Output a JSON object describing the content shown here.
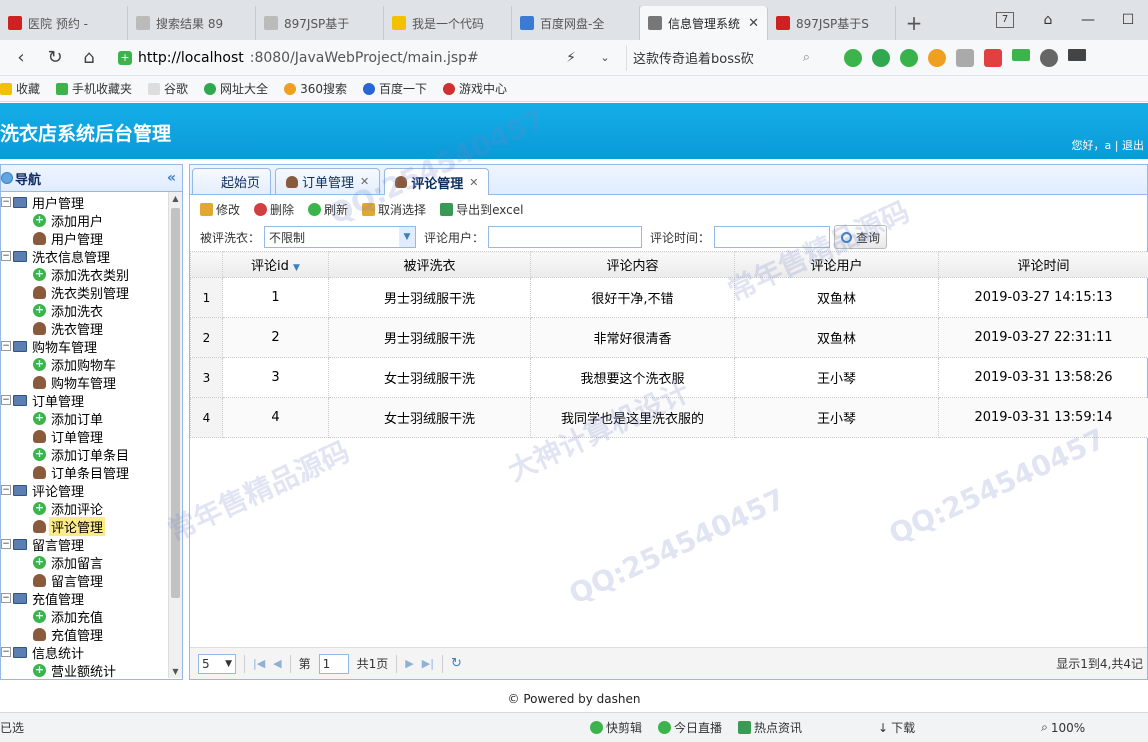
{
  "browser": {
    "tabs": [
      {
        "label": "医院 预约 -",
        "color": "#cc2222"
      },
      {
        "label": "搜索结果 89",
        "color": "#bbbbbb"
      },
      {
        "label": "897JSP基于",
        "color": "#bbbbbb"
      },
      {
        "label": "我是一个代码",
        "color": "#f2c200"
      },
      {
        "label": "百度网盘-全",
        "color": "#3b7bd4"
      },
      {
        "label": "信息管理系统",
        "color": "#777777",
        "active": true
      },
      {
        "label": "897JSP基于S",
        "color": "#cc2222"
      }
    ],
    "tab_count_badge": "7",
    "url_host": "http://localhost",
    "url_path": ":8080/JavaWebProject/main.jsp#",
    "search_text": "这款传奇追着boss砍",
    "bookmarks": [
      "收藏",
      "手机收藏夹",
      "谷歌",
      "网址大全",
      "360搜索",
      "百度一下",
      "游戏中心"
    ]
  },
  "app": {
    "title": "洗衣店系统后台管理",
    "user_greeting": "您好，a | 退出"
  },
  "nav": {
    "title": "导航",
    "tree": [
      {
        "type": "group",
        "label": "用户管理"
      },
      {
        "type": "add",
        "label": "添加用户"
      },
      {
        "type": "manage",
        "label": "用户管理"
      },
      {
        "type": "group",
        "label": "洗衣信息管理"
      },
      {
        "type": "add",
        "label": "添加洗衣类别"
      },
      {
        "type": "manage",
        "label": "洗衣类别管理"
      },
      {
        "type": "add",
        "label": "添加洗衣"
      },
      {
        "type": "manage",
        "label": "洗衣管理"
      },
      {
        "type": "group",
        "label": "购物车管理"
      },
      {
        "type": "add",
        "label": "添加购物车"
      },
      {
        "type": "manage",
        "label": "购物车管理"
      },
      {
        "type": "group",
        "label": "订单管理"
      },
      {
        "type": "add",
        "label": "添加订单"
      },
      {
        "type": "manage",
        "label": "订单管理"
      },
      {
        "type": "add",
        "label": "添加订单条目"
      },
      {
        "type": "manage",
        "label": "订单条目管理"
      },
      {
        "type": "group",
        "label": "评论管理"
      },
      {
        "type": "add",
        "label": "添加评论"
      },
      {
        "type": "manage",
        "label": "评论管理",
        "selected": true
      },
      {
        "type": "group",
        "label": "留言管理"
      },
      {
        "type": "add",
        "label": "添加留言"
      },
      {
        "type": "manage",
        "label": "留言管理"
      },
      {
        "type": "group",
        "label": "充值管理"
      },
      {
        "type": "add",
        "label": "添加充值"
      },
      {
        "type": "manage",
        "label": "充值管理"
      },
      {
        "type": "group",
        "label": "信息统计"
      },
      {
        "type": "add",
        "label": "营业额统计"
      }
    ]
  },
  "content_tabs": {
    "start": "起始页",
    "order": "订单管理",
    "comment": "评论管理"
  },
  "toolbar": {
    "edit": "修改",
    "delete": "删除",
    "refresh": "刷新",
    "cancel": "取消选择",
    "export": "导出到excel"
  },
  "filter": {
    "laundry_label": "被评洗衣：",
    "laundry_value": "不限制",
    "user_label": "评论用户：",
    "user_value": "",
    "time_label": "评论时间：",
    "time_value": "",
    "query_button": "查询"
  },
  "table": {
    "headers": [
      "评论id",
      "被评洗衣",
      "评论内容",
      "评论用户",
      "评论时间"
    ],
    "rows": [
      [
        "1",
        "1",
        "男士羽绒服干洗",
        "很好干净,不错",
        "双鱼林",
        "2019-03-27 14:15:13"
      ],
      [
        "2",
        "2",
        "男士羽绒服干洗",
        "非常好很清香",
        "双鱼林",
        "2019-03-27 22:31:11"
      ],
      [
        "3",
        "3",
        "女士羽绒服干洗",
        "我想要这个洗衣服",
        "王小琴",
        "2019-03-31 13:58:26"
      ],
      [
        "4",
        "4",
        "女士羽绒服干洗",
        "我同学也是这里洗衣服的",
        "王小琴",
        "2019-03-31 13:59:14"
      ]
    ]
  },
  "pager": {
    "page_size": "5",
    "page_prefix": "第",
    "page_number": "1",
    "page_total": "共1页",
    "info": "显示1到4,共4记"
  },
  "footer": "© Powered by dashen",
  "statusbar": {
    "left": "已选",
    "items": [
      "快剪辑",
      "今日直播",
      "热点资讯",
      "下载",
      "100%"
    ]
  },
  "watermarks": [
    "QQ:254540457",
    "常年售精品源码",
    "大神计算机设计"
  ]
}
